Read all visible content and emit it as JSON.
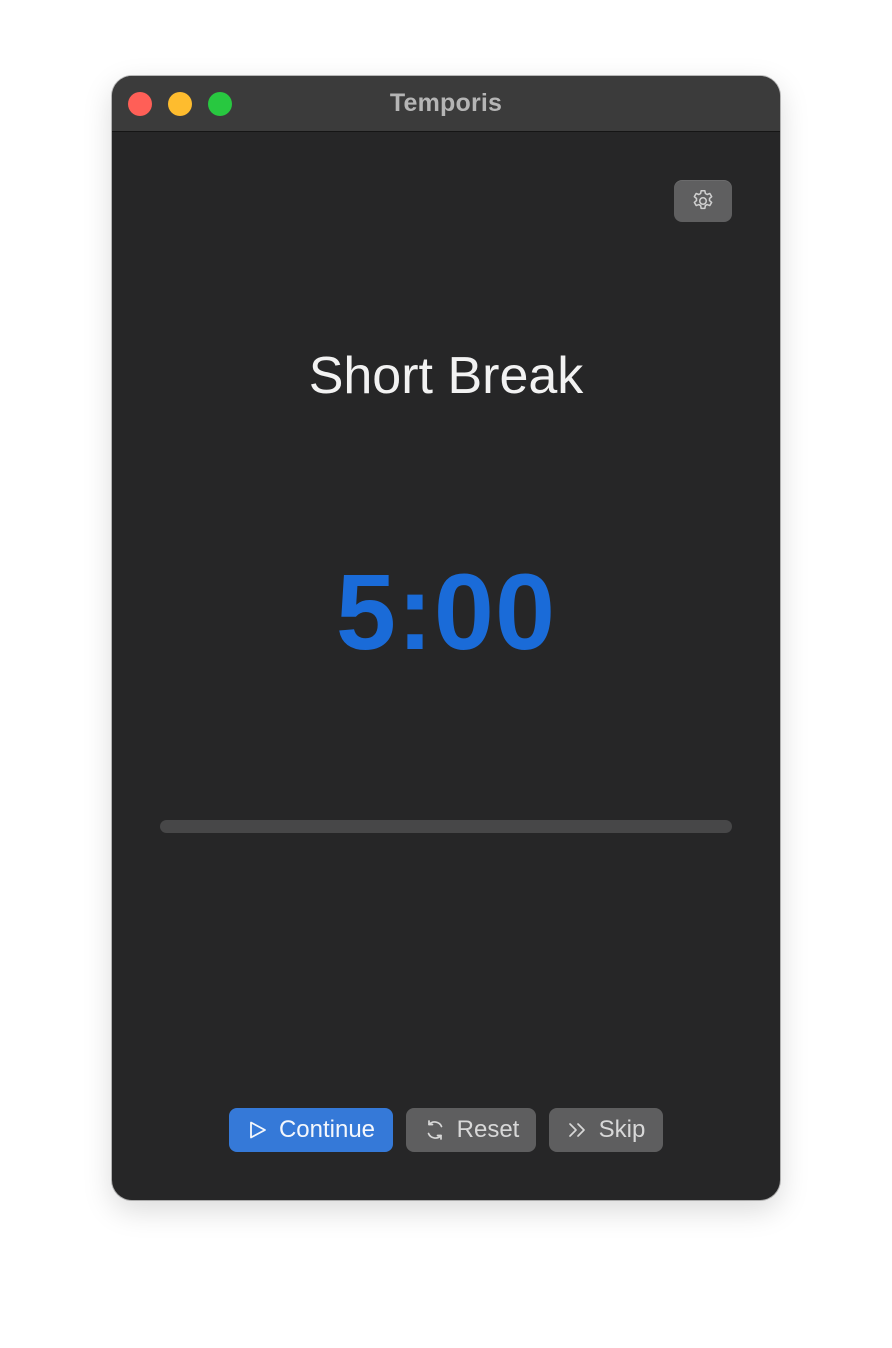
{
  "window": {
    "title": "Temporis",
    "traffic_lights": {
      "close_color": "#ff5f57",
      "minimize_color": "#febc2e",
      "zoom_color": "#28c840"
    }
  },
  "toolbar": {
    "settings_icon": "gear-icon"
  },
  "session": {
    "mode": "Short Break",
    "time_remaining": "5:00",
    "progress_fraction": 0.0
  },
  "controls": {
    "continue": {
      "label": "Continue",
      "icon": "play-icon"
    },
    "reset": {
      "label": "Reset",
      "icon": "refresh-icon"
    },
    "skip": {
      "label": "Skip",
      "icon": "skip-forward-icon"
    }
  },
  "colors": {
    "accent": "#1a6bd8",
    "primary_button": "#3579d8",
    "secondary_button": "#5e5e5f",
    "window_background": "#262627"
  }
}
